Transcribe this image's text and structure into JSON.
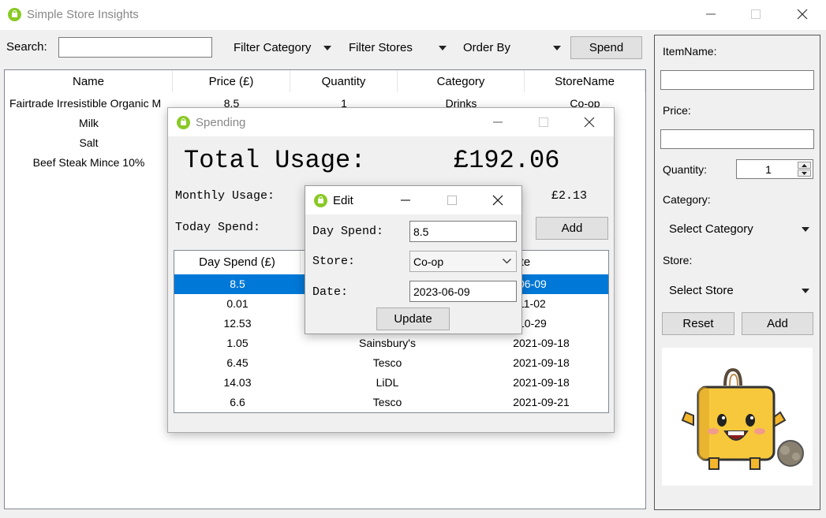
{
  "app": {
    "title": "Simple Store Insights",
    "toolbar": {
      "search_label": "Search:",
      "search_value": "",
      "filter_category": "Filter Category",
      "filter_stores": "Filter Stores",
      "order_by": "Order By",
      "spend_button": "Spend"
    },
    "items_table": {
      "columns": [
        "Name",
        "Price (£)",
        "Quantity",
        "Category",
        "StoreName"
      ],
      "rows": [
        [
          "Fairtrade Irresistible Organic M",
          "8.5",
          "1",
          "Drinks",
          "Co-op"
        ],
        [
          "Milk",
          "",
          "",
          "",
          ""
        ],
        [
          "Salt",
          "",
          "",
          "",
          ""
        ],
        [
          "Beef Steak Mince 10%",
          "",
          "",
          "",
          ""
        ]
      ]
    },
    "sidebar": {
      "item_name_label": "ItemName:",
      "item_name_value": "",
      "price_label": "Price:",
      "price_value": "",
      "quantity_label": "Quantity:",
      "quantity_value": "1",
      "category_label": "Category:",
      "category_select": "Select Category",
      "store_label": "Store:",
      "store_select": "Select Store",
      "reset_button": "Reset",
      "add_button": "Add"
    }
  },
  "spending_window": {
    "title": "Spending",
    "total_label": "Total Usage:",
    "total_value": "£192.06",
    "monthly_label": "Monthly Usage:",
    "monthly_value": "£2.13",
    "today_label": "Today Spend:",
    "add_button": "Add",
    "table": {
      "columns": [
        "Day Spend (£)",
        "Store",
        "Date"
      ],
      "rows": [
        [
          "8.5",
          "",
          "06-09"
        ],
        [
          "0.01",
          "",
          "11-02"
        ],
        [
          "12.53",
          "",
          "10-29"
        ],
        [
          "1.05",
          "Sainsbury's",
          "2021-09-18"
        ],
        [
          "6.45",
          "Tesco",
          "2021-09-18"
        ],
        [
          "14.03",
          "LiDL",
          "2021-09-18"
        ],
        [
          "6.6",
          "Tesco",
          "2021-09-21"
        ]
      ],
      "visible_header_fragment": "te"
    }
  },
  "edit_window": {
    "title": "Edit",
    "day_spend_label": "Day Spend:",
    "day_spend_value": "8.5",
    "store_label": "Store:",
    "store_value": "Co-op",
    "date_label": "Date:",
    "date_value": "2023-06-09",
    "update_button": "Update"
  },
  "colors": {
    "accent": "#8ac926",
    "selection": "#0078d7"
  }
}
